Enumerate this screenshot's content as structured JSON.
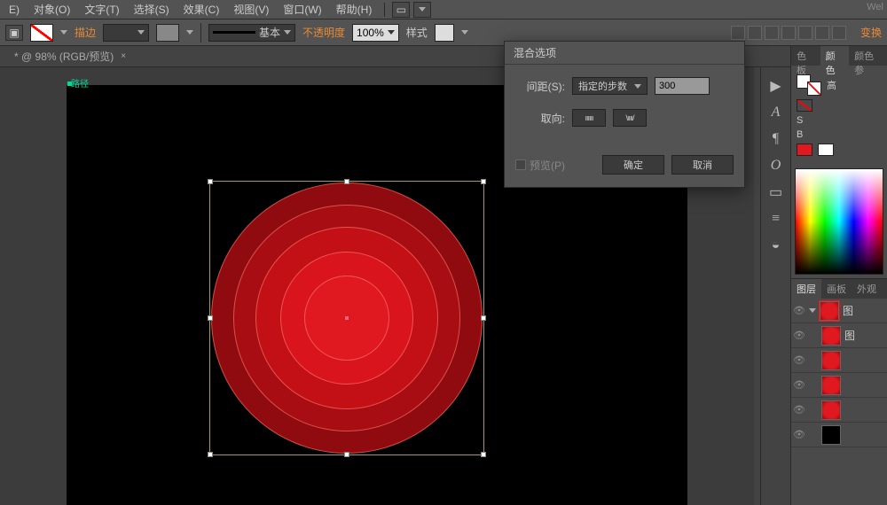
{
  "menu": {
    "edit": "E)",
    "object": "对象(O)",
    "type": "文字(T)",
    "select": "选择(S)",
    "effect": "效果(C)",
    "view": "视图(V)",
    "window": "窗口(W)",
    "help": "帮助(H)"
  },
  "brand": "Wel",
  "options": {
    "stroke_label": "描边",
    "stroke_style": "基本",
    "opacity_label": "不透明度",
    "opacity_value": "100%",
    "style_label": "样式",
    "transform_label": "变换"
  },
  "doc_tab": {
    "title": "* @ 98% (RGB/预览)",
    "close": "×"
  },
  "canvas": {
    "path_label": "路径"
  },
  "dialog": {
    "title": "混合选项",
    "spacing_label": "间距(S):",
    "spacing_mode": "指定的步数",
    "spacing_value": "300",
    "orient_label": "取向:",
    "orient_a": "ıııııı",
    "orient_b": "\\ıııı/",
    "preview": "预览(P)",
    "ok": "确定",
    "cancel": "取消"
  },
  "color_panel": {
    "tab_swatch": "色板",
    "tab_color": "颜色",
    "tab_guide": "颜色参",
    "label_h": "高",
    "label_s": "S",
    "label_b": "B"
  },
  "layers_panel": {
    "tab_layers": "图层",
    "tab_artboards": "画板",
    "tab_appearance": "外观",
    "group_label": "图",
    "item_label": "图"
  }
}
